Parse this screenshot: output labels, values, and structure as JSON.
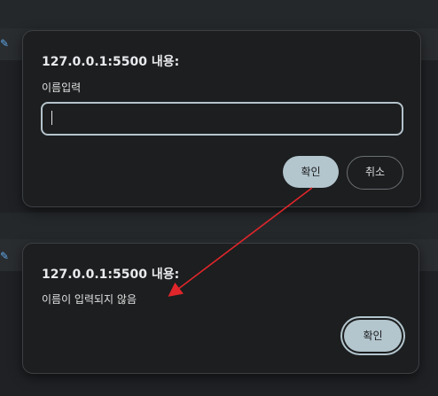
{
  "dialog_top": {
    "title": "127.0.0.1:5500 내용:",
    "message": "이름입력",
    "input_value": "",
    "ok_label": "확인",
    "cancel_label": "취소"
  },
  "dialog_bottom": {
    "title": "127.0.0.1:5500 내용:",
    "message": "이름이 입력되지 않음",
    "ok_label": "확인"
  },
  "annotation": {
    "arrow_color": "#e0262b"
  },
  "colors": {
    "dialog_bg": "#1c1e1f",
    "ok_button_bg": "#b3c5cd",
    "page_bg": "#1f2124"
  }
}
